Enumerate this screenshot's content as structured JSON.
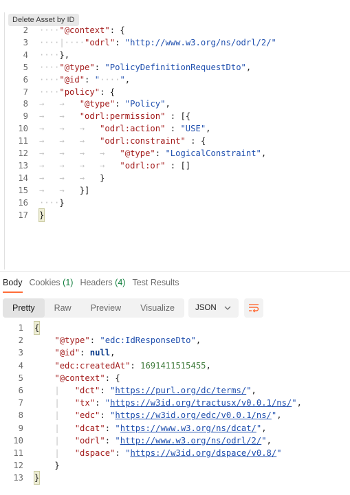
{
  "tooltip": {
    "text": "Delete Asset by ID"
  },
  "request_body": {
    "lines": [
      {
        "n": "2",
        "html": "<span class='ws'>····</span><span class='k'>\"@context\"</span><span class='p'>: {</span>"
      },
      {
        "n": "3",
        "html": "<span class='ws'>····|····</span><span class='k'>\"odrl\"</span><span class='p'>: </span><span class='s'>\"http://www.w3.org/ns/odrl/2/\"</span>"
      },
      {
        "n": "4",
        "html": "<span class='ws'>····</span><span class='p'>},</span>"
      },
      {
        "n": "5",
        "html": "<span class='ws'>····</span><span class='k'>\"@type\"</span><span class='p'>: </span><span class='s'>\"PolicyDefinitionRequestDto\"</span><span class='p'>,</span>"
      },
      {
        "n": "6",
        "html": "<span class='ws'>····</span><span class='k'>\"@id\"</span><span class='p'>: </span><span class='s'>\"<span class='ws'>····</span>\"</span><span class='p'>,</span>"
      },
      {
        "n": "7",
        "html": "<span class='ws'>····</span><span class='k'>\"policy\"</span><span class='p'>: {</span>"
      },
      {
        "n": "8",
        "html": "<span class='ws'>→   →   </span><span class='k'>\"@type\"</span><span class='p'>: </span><span class='s'>\"Policy\"</span><span class='p'>,</span>"
      },
      {
        "n": "9",
        "html": "<span class='ws'>→   →   </span><span class='k'>\"odrl:permission\"</span><span class='p'> : [{</span>"
      },
      {
        "n": "10",
        "html": "<span class='ws'>→   →   →   </span><span class='k'>\"odrl:action\"</span><span class='p'> : </span><span class='s'>\"USE\"</span><span class='p'>,</span>"
      },
      {
        "n": "11",
        "html": "<span class='ws'>→   →   →   </span><span class='k'>\"odrl:constraint\"</span><span class='p'> : {</span>"
      },
      {
        "n": "12",
        "html": "<span class='ws'>→   →   →   →   </span><span class='k'>\"@type\"</span><span class='p'>: </span><span class='s'>\"LogicalConstraint\"</span><span class='p'>,</span>"
      },
      {
        "n": "13",
        "html": "<span class='ws'>→   →   →   →   </span><span class='k'>\"odrl:or\"</span><span class='p'> : []</span>"
      },
      {
        "n": "14",
        "html": "<span class='ws'>→   →   →   </span><span class='p'>}</span>"
      },
      {
        "n": "15",
        "html": "<span class='ws'>→   →   </span><span class='p'>}]</span>"
      },
      {
        "n": "16",
        "html": "<span class='ws'>····</span><span class='p'>}</span>"
      },
      {
        "n": "17",
        "html": "<span class='br p'>}</span>"
      }
    ]
  },
  "response_tabs": [
    {
      "label": "Body",
      "count": "",
      "active": true
    },
    {
      "label": "Cookies",
      "count": "(1)",
      "active": false
    },
    {
      "label": "Headers",
      "count": "(4)",
      "active": false
    },
    {
      "label": "Test Results",
      "count": "",
      "active": false
    }
  ],
  "view_modes": [
    "Pretty",
    "Raw",
    "Preview",
    "Visualize"
  ],
  "format_select": {
    "value": "JSON"
  },
  "response_body": {
    "lines": [
      {
        "n": "1",
        "html": "<span class='br p'>{</span>"
      },
      {
        "n": "2",
        "html": "<span class='ws'>    </span><span class='k'>\"@type\"</span><span class='p'>: </span><span class='s'>\"edc:IdResponseDto\"</span><span class='p'>,</span>"
      },
      {
        "n": "3",
        "html": "<span class='ws'>    </span><span class='k'>\"@id\"</span><span class='p'>: </span><span class='kw'>null</span><span class='p'>,</span>"
      },
      {
        "n": "4",
        "html": "<span class='ws'>    </span><span class='k'>\"edc:createdAt\"</span><span class='p'>: </span><span class='n'>1691411515455</span><span class='p'>,</span>"
      },
      {
        "n": "5",
        "html": "<span class='ws'>    </span><span class='k'>\"@context\"</span><span class='p'>: {</span>"
      },
      {
        "n": "6",
        "html": "<span class='ws'>    |   </span><span class='k'>\"dct\"</span><span class='p'>: </span><span class='s'>\"<span class='u'>https://purl.org/dc/terms/</span>\"</span><span class='p'>,</span>"
      },
      {
        "n": "7",
        "html": "<span class='ws'>    |   </span><span class='k'>\"tx\"</span><span class='p'>: </span><span class='s'>\"<span class='u'>https://w3id.org/tractusx/v0.0.1/ns/</span>\"</span><span class='p'>,</span>"
      },
      {
        "n": "8",
        "html": "<span class='ws'>    |   </span><span class='k'>\"edc\"</span><span class='p'>: </span><span class='s'>\"<span class='u'>https://w3id.org/edc/v0.0.1/ns/</span>\"</span><span class='p'>,</span>"
      },
      {
        "n": "9",
        "html": "<span class='ws'>    |   </span><span class='k'>\"dcat\"</span><span class='p'>: </span><span class='s'>\"<span class='u'>https://www.w3.org/ns/dcat/</span>\"</span><span class='p'>,</span>"
      },
      {
        "n": "10",
        "html": "<span class='ws'>    |   </span><span class='k'>\"odrl\"</span><span class='p'>: </span><span class='s'>\"<span class='u'>http://www.w3.org/ns/odrl/2/</span>\"</span><span class='p'>,</span>"
      },
      {
        "n": "11",
        "html": "<span class='ws'>    |   </span><span class='k'>\"dspace\"</span><span class='p'>: </span><span class='s'>\"<span class='u'>https://w3id.org/dspace/v0.8/</span>\"</span>"
      },
      {
        "n": "12",
        "html": "<span class='ws'>    </span><span class='p'>}</span>"
      },
      {
        "n": "13",
        "html": "<span class='br p'>}</span>"
      }
    ]
  }
}
